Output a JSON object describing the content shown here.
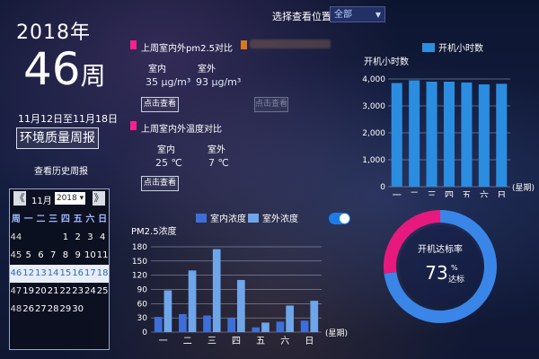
{
  "summary": {
    "year": "2018年",
    "week_number": "46",
    "week_unit": "周",
    "date_range": "11月12日至11月18日",
    "report_title": "环境质量周报",
    "history_link": "查看历史周报"
  },
  "calendar": {
    "prev": "《",
    "next": "》",
    "month": "11月",
    "year": "2018",
    "header": [
      "周",
      "一",
      "二",
      "三",
      "四",
      "五",
      "六",
      "日"
    ],
    "weeks": [
      [
        "44",
        "",
        "",
        "",
        "1",
        "2",
        "3",
        "4"
      ],
      [
        "45",
        "5",
        "6",
        "7",
        "8",
        "9",
        "10",
        "11"
      ],
      [
        "46",
        "12",
        "13",
        "14",
        "15",
        "16",
        "17",
        "18"
      ],
      [
        "47",
        "19",
        "20",
        "21",
        "22",
        "23",
        "24",
        "25"
      ],
      [
        "48",
        "26",
        "27",
        "28",
        "29",
        "30",
        "",
        ""
      ]
    ],
    "highlight_week": "46"
  },
  "location": {
    "label": "选择查看位置",
    "selected": "全部"
  },
  "pm25_card": {
    "title": "上周室内外pm2.5对比",
    "indoor_label": "室内",
    "outdoor_label": "室外",
    "indoor_value": "35 μg/m³",
    "outdoor_value": "93 μg/m³",
    "button": "点击查看"
  },
  "ghost_card": {
    "button": "点击查看"
  },
  "temp_card": {
    "title": "上周室内外温度对比",
    "indoor_label": "室内",
    "outdoor_label": "室外",
    "indoor_value": "25 ℃",
    "outdoor_value": "7 ℃",
    "button": "点击查看"
  },
  "colors": {
    "accent_pink": "#ff1f8d",
    "bar_blue": "#2b8de0",
    "indoor_blue": "#3e6fd8",
    "outdoor_blue": "#6fa6ea",
    "toggle_blue": "#1e7be6"
  },
  "chart_data": [
    {
      "type": "bar",
      "title": "",
      "legend": [
        "开机小时数"
      ],
      "ylabel": "开机小时数",
      "xlabel": "(星期)",
      "categories": [
        "一",
        "二",
        "三",
        "四",
        "五",
        "六",
        "日"
      ],
      "series": [
        {
          "name": "开机小时数",
          "values": [
            3850,
            3950,
            3900,
            3900,
            3870,
            3800,
            3820
          ]
        }
      ],
      "ylim": [
        0,
        4000
      ],
      "yticks": [
        "0",
        "1,000",
        "2,000",
        "3,000",
        "4,000"
      ],
      "grid": true,
      "legend_position": "top"
    },
    {
      "type": "bar",
      "title": "",
      "ylabel": "PM2.5浓度",
      "xlabel": "(星期)",
      "categories": [
        "一",
        "二",
        "三",
        "四",
        "五",
        "六",
        "日"
      ],
      "series": [
        {
          "name": "室内浓度",
          "values": [
            32,
            38,
            35,
            30,
            10,
            22,
            24
          ]
        },
        {
          "name": "室外浓度",
          "values": [
            88,
            130,
            175,
            110,
            20,
            56,
            66
          ]
        }
      ],
      "ylim": [
        0,
        180
      ],
      "yticks": [
        "0",
        "30",
        "60",
        "90",
        "120",
        "150",
        "180"
      ],
      "grid": true,
      "legend_position": "top"
    },
    {
      "type": "pie",
      "title": "开机达标率",
      "value_label": "73",
      "unit": "%",
      "sub_label": "达标",
      "slices": [
        {
          "name": "达标",
          "value": 73
        },
        {
          "name": "",
          "value": 27
        }
      ]
    }
  ]
}
